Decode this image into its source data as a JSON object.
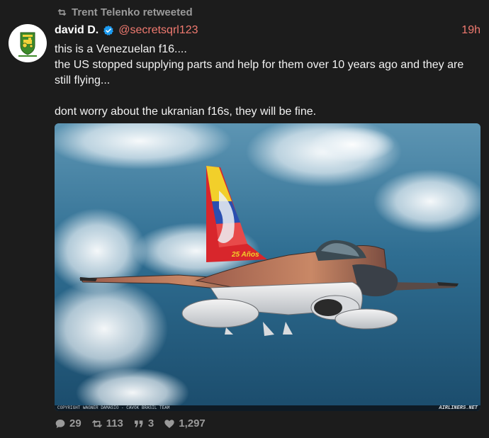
{
  "retweet": {
    "label": "Trent Telenko retweeted",
    "icon": "retweet-icon"
  },
  "author": {
    "name": "david D.",
    "handle": "@secretsqrl123",
    "verified": true,
    "timestamp": "19h",
    "avatar_icon": "tractor-badge-icon"
  },
  "body": {
    "lines": [
      "this is a Venezuelan f16....",
      "the US stopped supplying parts and help for them over 10 years ago and they are still flying...",
      "dont worry about the ukranian f16s, they will be fine."
    ]
  },
  "media": {
    "alt_subject": "f16-jet-photo",
    "credit": "COPYRIGHT WAGNER DAMASIO - CAVOK BRASIL TEAM",
    "watermark": "AIRLINERS.NET"
  },
  "actions": {
    "replies": "29",
    "retweets": "113",
    "quotes": "3",
    "likes": "1,297"
  },
  "colors": {
    "background": "#1c1c1c",
    "muted": "#9a9a9a",
    "handle": "#f07a70",
    "verified": "#1d9bf0"
  }
}
